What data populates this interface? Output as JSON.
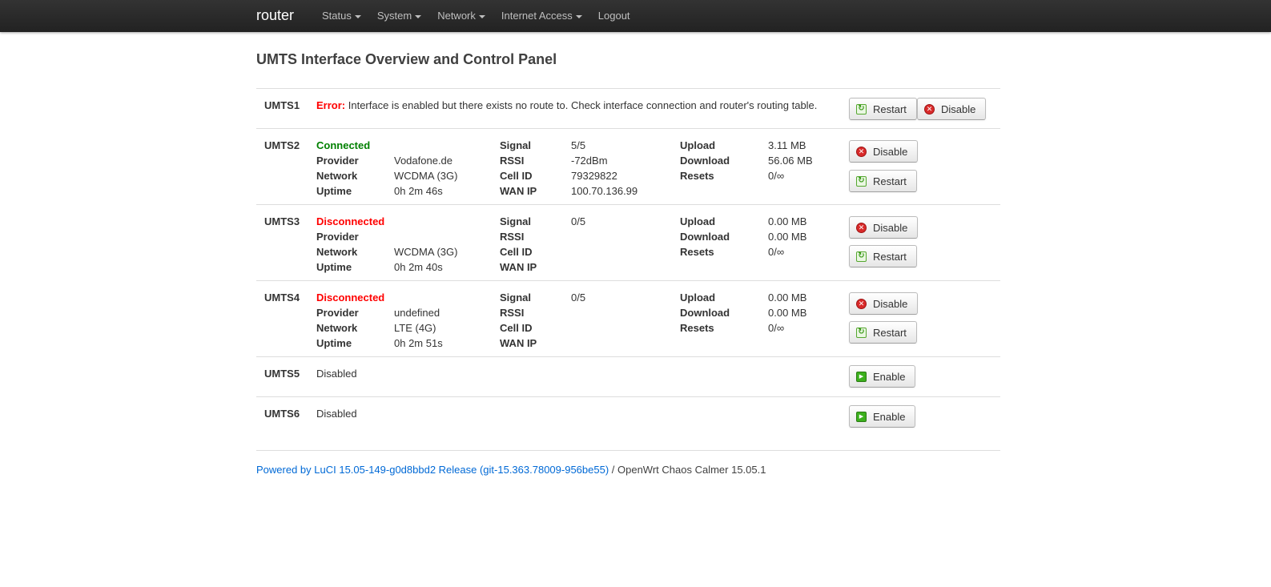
{
  "navbar": {
    "brand": "router",
    "menu": [
      {
        "label": "Status",
        "dropdown": true
      },
      {
        "label": "System",
        "dropdown": true
      },
      {
        "label": "Network",
        "dropdown": true
      },
      {
        "label": "Internet Access",
        "dropdown": true
      },
      {
        "label": "Logout",
        "dropdown": false
      }
    ]
  },
  "page": {
    "title": "UMTS Interface Overview and Control Panel"
  },
  "labels": {
    "provider": "Provider",
    "network": "Network",
    "uptime": "Uptime",
    "signal": "Signal",
    "rssi": "RSSI",
    "cell_id": "Cell ID",
    "wan_ip": "WAN IP",
    "upload": "Upload",
    "download": "Download",
    "resets": "Resets",
    "error": "Error:"
  },
  "buttons": {
    "restart": "Restart",
    "disable": "Disable",
    "enable": "Enable"
  },
  "interfaces": [
    {
      "name": "UMTS1",
      "error_message": " Interface is enabled but there exists no route to. Check interface connection and router's routing table."
    },
    {
      "name": "UMTS2",
      "status": "Connected",
      "provider": "Vodafone.de",
      "network": "WCDMA (3G)",
      "uptime": "0h 2m 46s",
      "signal": "5/5",
      "rssi": "-72dBm",
      "cell_id": "79329822",
      "wan_ip": "100.70.136.99",
      "upload": "3.11 MB",
      "download": "56.06 MB",
      "resets": "0/∞"
    },
    {
      "name": "UMTS3",
      "status": "Disconnected",
      "provider": "",
      "network": "WCDMA (3G)",
      "uptime": "0h 2m 40s",
      "signal": "0/5",
      "rssi": "",
      "cell_id": "",
      "wan_ip": "",
      "upload": "0.00 MB",
      "download": "0.00 MB",
      "resets": "0/∞"
    },
    {
      "name": "UMTS4",
      "status": "Disconnected",
      "provider": "undefined",
      "network": "LTE (4G)",
      "uptime": "0h 2m 51s",
      "signal": "0/5",
      "rssi": "",
      "cell_id": "",
      "wan_ip": "",
      "upload": "0.00 MB",
      "download": "0.00 MB",
      "resets": "0/∞"
    },
    {
      "name": "UMTS5",
      "status": "Disabled"
    },
    {
      "name": "UMTS6",
      "status": "Disabled"
    }
  ],
  "icons": {
    "restart": "refresh-icon",
    "disable": "stop-circle-icon",
    "enable": "play-icon",
    "dropdown": "caret-down-icon"
  },
  "colors": {
    "connected": "#008000",
    "disconnected": "#ff0000",
    "error": "#ff0000",
    "link": "#0069d6",
    "navbar": "#222222"
  },
  "footer": {
    "link_text": "Powered by LuCI 15.05-149-g0d8bbd2 Release (git-15.363.78009-956be55)",
    "separator": " / ",
    "suffix": "OpenWrt Chaos Calmer 15.05.1"
  }
}
